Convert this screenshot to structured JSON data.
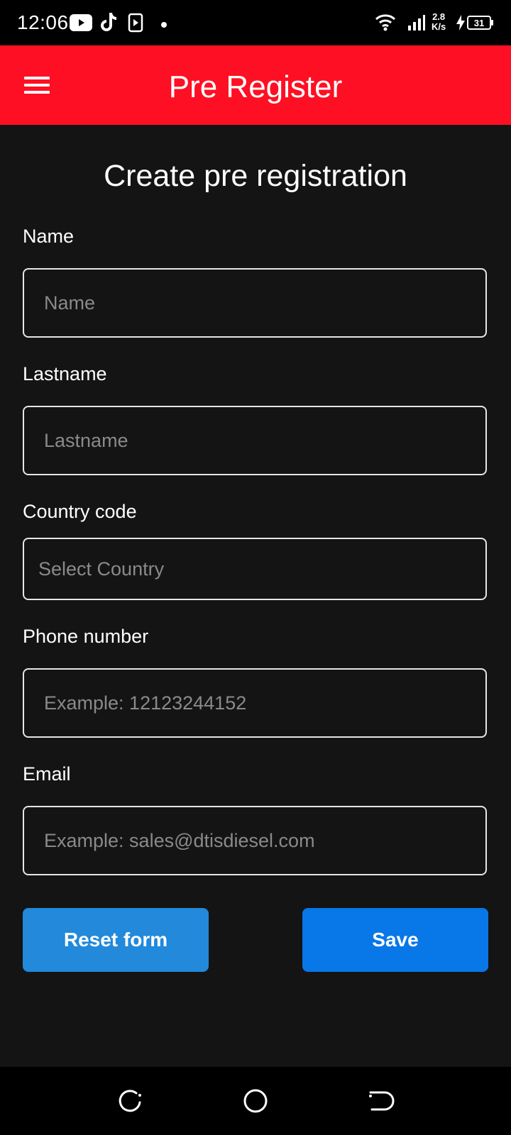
{
  "status_bar": {
    "time": "12:06",
    "speed_value": "2.8",
    "speed_unit": "K/s",
    "battery": "31",
    "icons": [
      "youtube-icon",
      "tiktok-icon",
      "media-play-icon",
      "dot-icon",
      "wifi-icon",
      "signal-icon",
      "charging-icon",
      "battery-icon"
    ]
  },
  "app_bar": {
    "title": "Pre Register",
    "menu_icon": "hamburger-menu-icon",
    "color": "#FF0F23"
  },
  "form": {
    "title": "Create pre registration",
    "fields": {
      "name": {
        "label": "Name",
        "placeholder": "Name"
      },
      "lastname": {
        "label": "Lastname",
        "placeholder": "Lastname"
      },
      "country_code": {
        "label": "Country code",
        "placeholder": "Select Country"
      },
      "phone": {
        "label": "Phone number",
        "placeholder": "Example: 12123244152"
      },
      "email": {
        "label": "Email",
        "placeholder": "Example: sales@dtisdiesel.com"
      }
    },
    "buttons": {
      "reset": "Reset form",
      "save": "Save"
    },
    "colors": {
      "background": "#141414",
      "reset_button": "#2289DB",
      "save_button": "#0877E8"
    }
  },
  "nav_bar": {
    "icons": [
      "recent-apps-icon",
      "home-icon",
      "back-icon"
    ]
  }
}
